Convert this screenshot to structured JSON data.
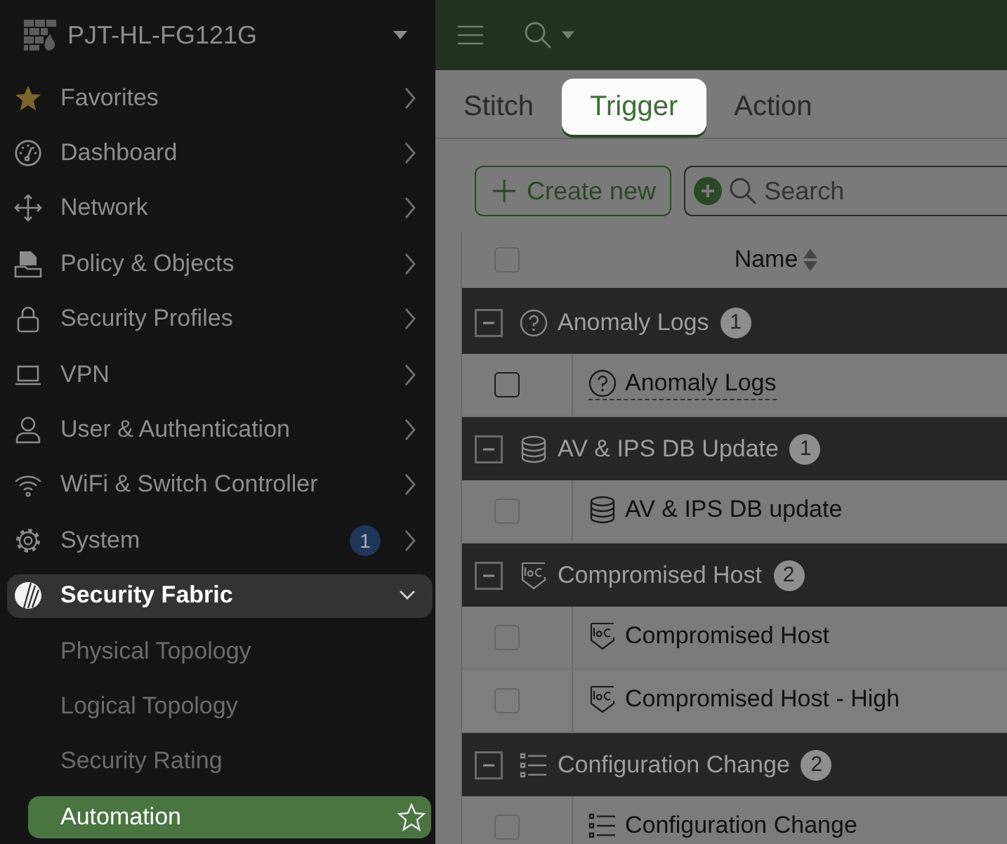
{
  "sidebar": {
    "device": "PJT-HL-FG121G",
    "items": [
      {
        "label": "Favorites",
        "expanded": false
      },
      {
        "label": "Dashboard",
        "expanded": false
      },
      {
        "label": "Network",
        "expanded": false
      },
      {
        "label": "Policy & Objects",
        "expanded": false
      },
      {
        "label": "Security Profiles",
        "expanded": false
      },
      {
        "label": "VPN",
        "expanded": false
      },
      {
        "label": "User & Authentication",
        "expanded": false
      },
      {
        "label": "WiFi & Switch Controller",
        "expanded": false
      },
      {
        "label": "System",
        "expanded": false,
        "badge": "1"
      },
      {
        "label": "Security Fabric",
        "expanded": true,
        "children": [
          {
            "label": "Physical Topology",
            "selected": false
          },
          {
            "label": "Logical Topology",
            "selected": false
          },
          {
            "label": "Security Rating",
            "selected": false
          },
          {
            "label": "Automation",
            "selected": true
          }
        ]
      }
    ]
  },
  "tabs": [
    {
      "label": "Stitch",
      "selected": false
    },
    {
      "label": "Trigger",
      "selected": true
    },
    {
      "label": "Action",
      "selected": false
    }
  ],
  "toolbar": {
    "create_button": "Create new",
    "search": {
      "placeholder": "Search"
    }
  },
  "table": {
    "columns": [
      "Name"
    ],
    "select_all": {
      "checked": false
    },
    "groups": [
      {
        "label": "Anomaly Logs",
        "count": "1",
        "expanded": true,
        "rows": [
          {
            "label": "Anomaly Logs",
            "checked": false,
            "focused": true
          }
        ]
      },
      {
        "label": "AV & IPS DB Update",
        "count": "1",
        "expanded": true,
        "rows": [
          {
            "label": "AV & IPS DB update",
            "checked": false,
            "focused": false
          }
        ]
      },
      {
        "label": "Compromised Host",
        "count": "2",
        "expanded": true,
        "rows": [
          {
            "label": "Compromised Host",
            "checked": false,
            "focused": false
          },
          {
            "label": "Compromised Host - High",
            "checked": false,
            "focused": false
          }
        ]
      },
      {
        "label": "Configuration Change",
        "count": "2",
        "expanded": true,
        "rows": [
          {
            "label": "Configuration Change",
            "checked": false,
            "focused": false
          }
        ]
      }
    ]
  }
}
